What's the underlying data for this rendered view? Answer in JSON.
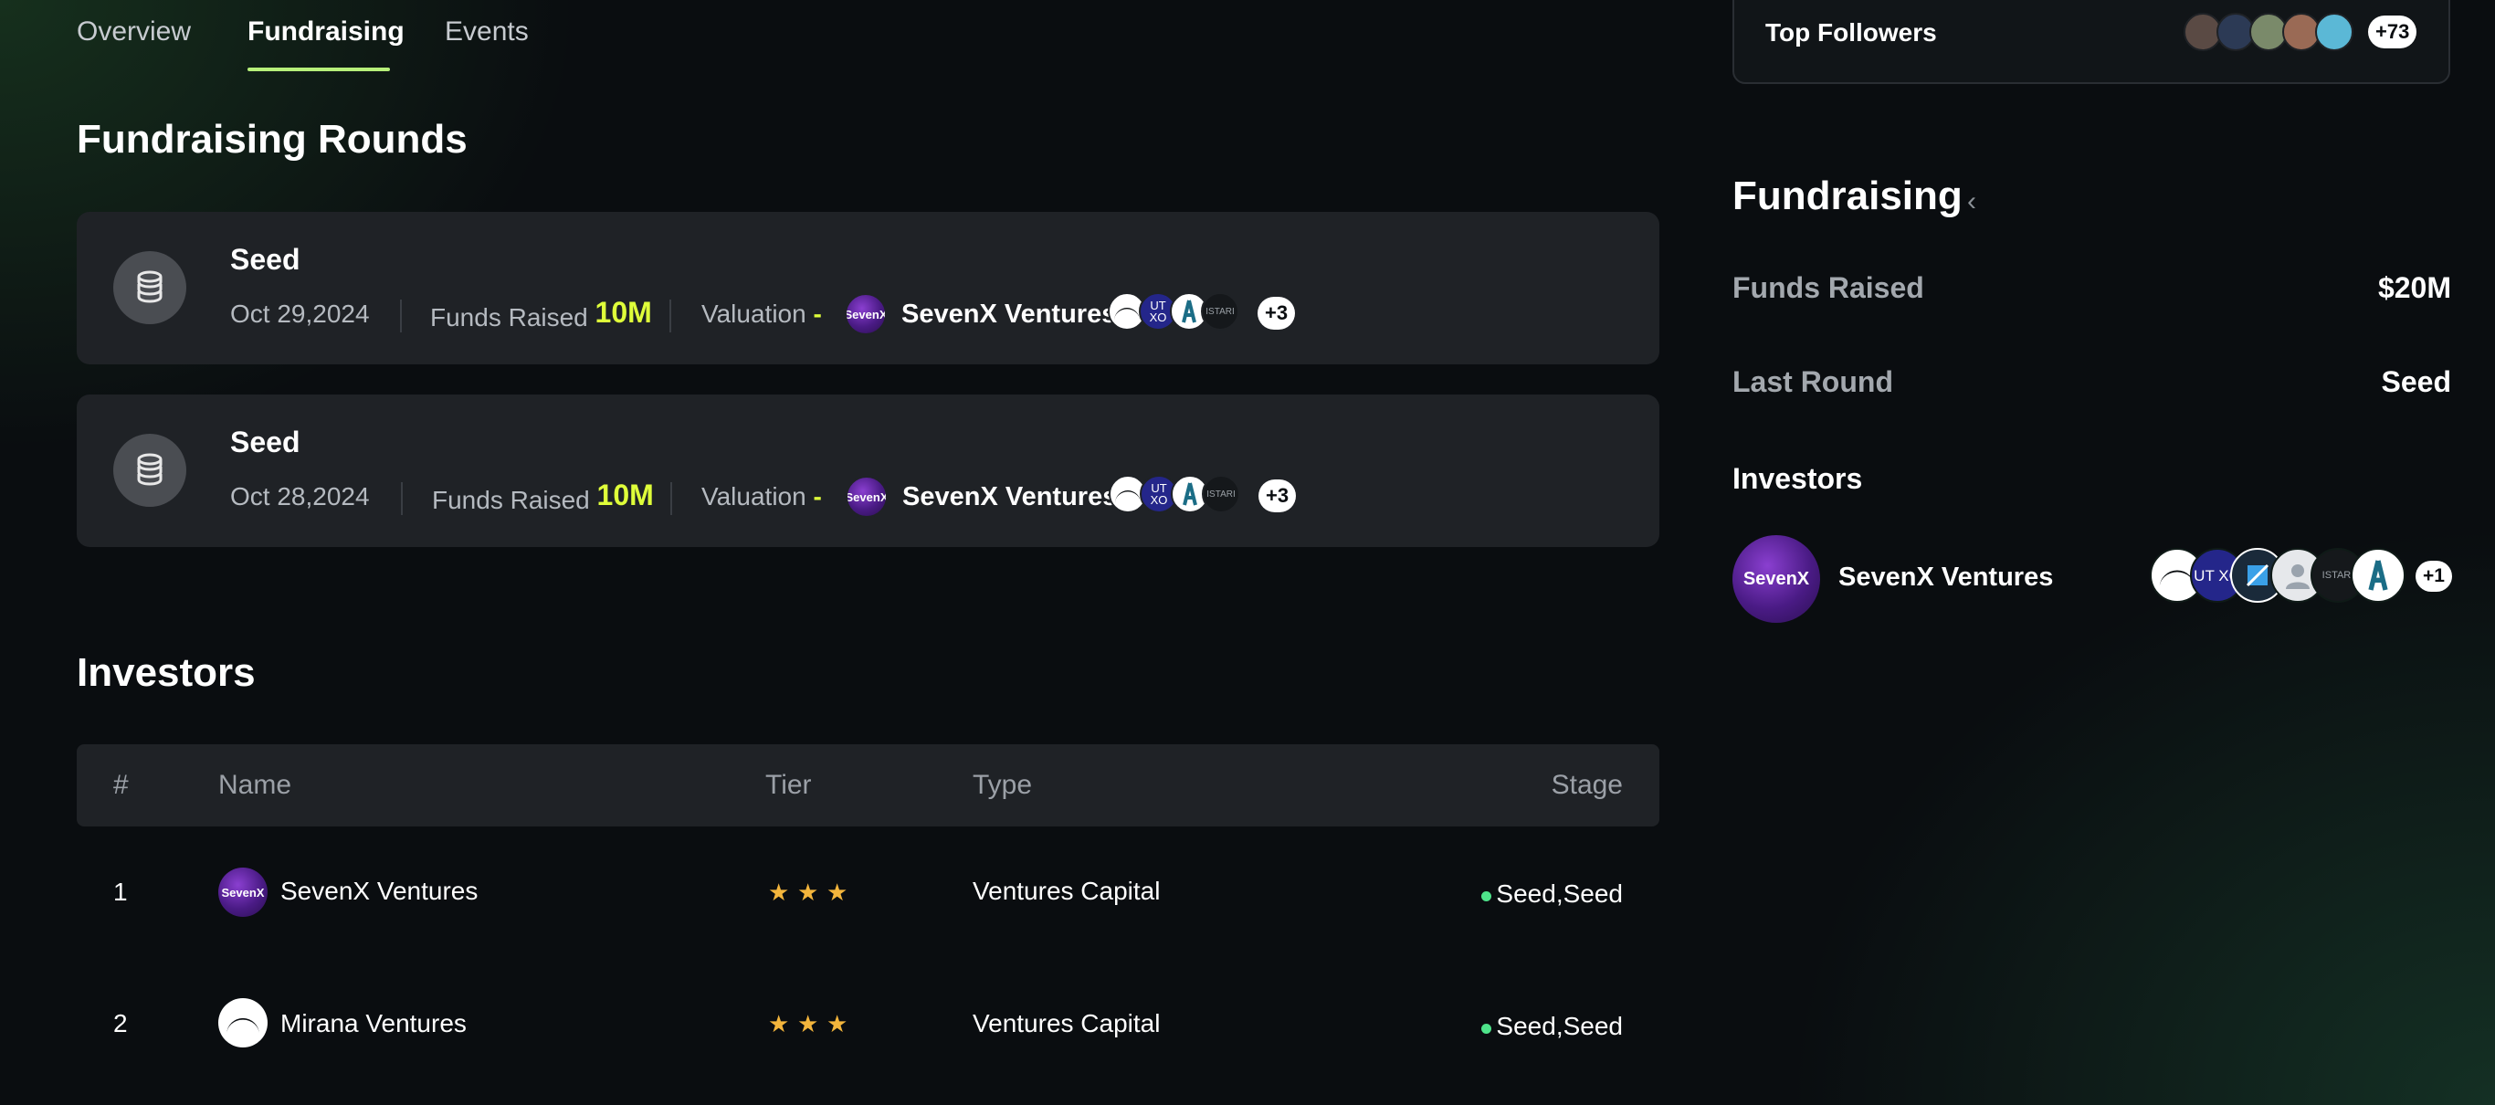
{
  "tabs": [
    {
      "label": "Overview"
    },
    {
      "label": "Fundraising"
    },
    {
      "label": "Events"
    }
  ],
  "fundraising_rounds": {
    "title": "Fundraising Rounds",
    "rounds": [
      {
        "stage": "Seed",
        "date": "Oct 29,2024",
        "funds_label": "Funds Raised",
        "funds_value": "10M",
        "valuation_label": "Valuation",
        "valuation_value": "-",
        "lead_logo": "SevenX",
        "lead_investor": "SevenX Ventures",
        "more_investors": "+3"
      },
      {
        "stage": "Seed",
        "date": "Oct 28,2024",
        "funds_label": "Funds Raised",
        "funds_value": "10M",
        "valuation_label": "Valuation",
        "valuation_value": "-",
        "lead_logo": "SevenX",
        "lead_investor": "SevenX Ventures",
        "more_investors": "+3"
      }
    ],
    "investor_avatar_icons": [
      "mirana-logo-icon",
      "utxo-logo-icon",
      "arweave-logo-icon",
      "istari-logo-icon"
    ],
    "utxo_text": "UT XO",
    "istari_text": "ISTARI"
  },
  "investors_table": {
    "title": "Investors",
    "columns": {
      "num": "#",
      "name": "Name",
      "tier": "Tier",
      "type": "Type",
      "stage": "Stage"
    },
    "rows": [
      {
        "num": "1",
        "logo": "SevenX",
        "name": "SevenX Ventures",
        "tier_stars": 3,
        "type": "Ventures Capital",
        "stage": "Seed,Seed"
      },
      {
        "num": "2",
        "name": "Mirana Ventures",
        "tier_stars": 3,
        "type": "Ventures Capital",
        "stage": "Seed,Seed"
      }
    ]
  },
  "sidebar": {
    "top_followers": {
      "label": "Top Followers",
      "more": "+73"
    },
    "fundraising": {
      "title": "Fundraising",
      "funds_raised_label": "Funds Raised",
      "funds_raised_value": "$20M",
      "last_round_label": "Last Round",
      "last_round_value": "Seed",
      "investors_label": "Investors",
      "lead_logo": "SevenX",
      "lead_investor": "SevenX Ventures",
      "more_investors": "+1"
    }
  },
  "colors": {
    "accent_green": "#dfff3a",
    "tab_underline": "#b7f07a",
    "star": "#f3b53c",
    "status_dot": "#4ee38a"
  }
}
